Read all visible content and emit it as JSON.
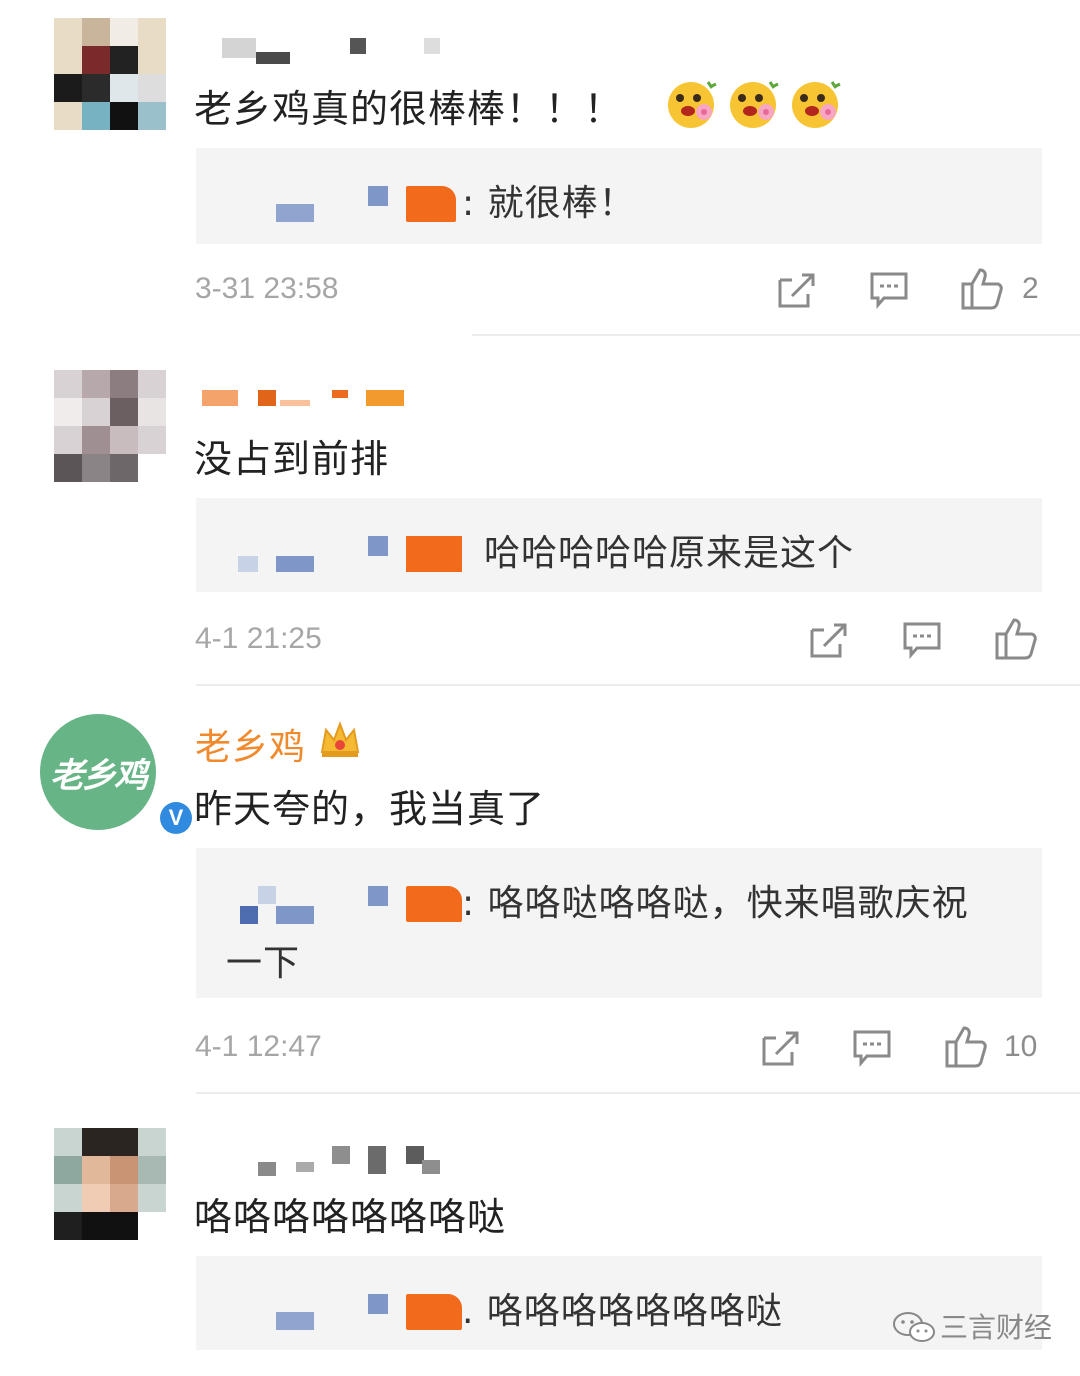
{
  "comments": [
    {
      "text": "老乡鸡真的很棒棒！！！",
      "emoji": [
        "flower-face-emoji",
        "flower-face-emoji",
        "flower-face-emoji"
      ],
      "reply": {
        "text": ": 就很棒！"
      },
      "timestamp": "3-31 23:58",
      "like_count": "2"
    },
    {
      "text": "没占到前排",
      "reply": {
        "text": "哈哈哈哈哈原来是这个"
      },
      "timestamp": "4-1 21:25",
      "like_count": ""
    },
    {
      "author": "老乡鸡",
      "avatar_text": "老乡鸡",
      "verified_mark": "V",
      "text": "昨天夸的，我当真了",
      "reply": {
        "text_line1": ": 咯咯哒咯咯哒，快来唱歌庆祝",
        "text_line2": "一下"
      },
      "timestamp": "4-1 12:47",
      "like_count": "10"
    },
    {
      "text": "咯咯咯咯咯咯咯哒",
      "reply": {
        "text": ". 咯咯咯咯咯咯咯哒"
      }
    }
  ],
  "watermark": {
    "label": "三言财经",
    "icon": "wechat-icon"
  },
  "colors": {
    "official_name": "#f08a2d",
    "avatar_green": "#67b487",
    "verify_blue": "#2f8ae0"
  }
}
